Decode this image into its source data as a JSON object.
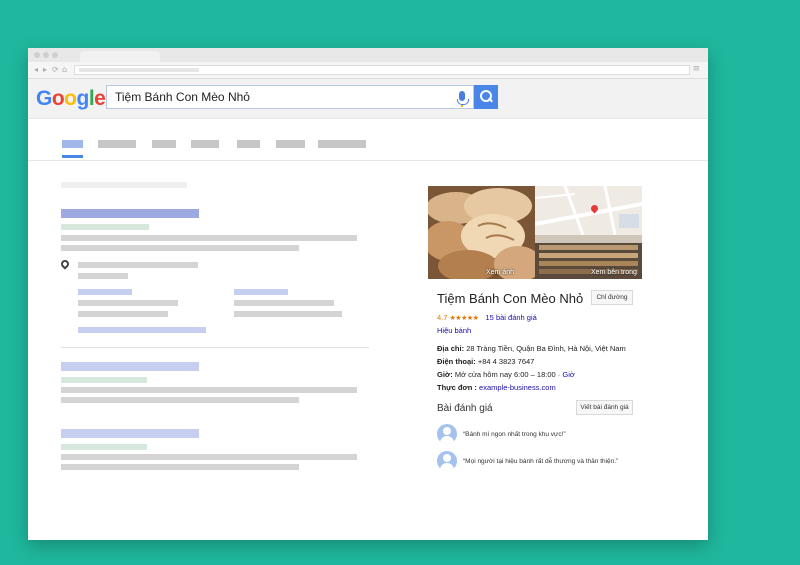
{
  "browser": {
    "menu_glyph": "≡",
    "nav_glyphs": [
      "◂",
      "▸",
      "⟳",
      "⌂"
    ]
  },
  "google": {
    "logo_letters": [
      {
        "ch": "G",
        "color": "#4285f4"
      },
      {
        "ch": "o",
        "color": "#ea4335"
      },
      {
        "ch": "o",
        "color": "#fbbc05"
      },
      {
        "ch": "g",
        "color": "#4285f4"
      },
      {
        "ch": "l",
        "color": "#34a853"
      },
      {
        "ch": "e",
        "color": "#ea4335"
      }
    ],
    "query": "Tiệm Bánh Con Mèo Nhỏ"
  },
  "knowledge_panel": {
    "photo_caption": "Xem ảnh",
    "store_caption": "Xem bên trong",
    "title": "Tiệm Bánh Con Mèo Nhỏ",
    "directions_button": "Chỉ đường",
    "rating_value": "4.7",
    "stars": "★★★★★",
    "review_count": "15 bài đánh giá",
    "category": "Hiệu bánh",
    "address_label": "Địa chỉ:",
    "address_value": "28 Tràng Tiền, Quận Ba Đình, Hà Nội, Việt Nam",
    "phone_label": "Điện thoại:",
    "phone_value": "+84 4 3823 7647",
    "hours_label": "Giờ:",
    "hours_value": "Mở cửa hôm nay 6:00 – 18:00 ·",
    "hours_link": "Giờ",
    "menu_label": "Thực đơn :",
    "menu_link": "example-business.com",
    "reviews_heading": "Bài đánh giá",
    "write_review_button": "Viết bài đánh giá",
    "reviews": [
      "“Bánh mì ngon nhất trong khu vực!”",
      "“Mọi người tại hiệu bánh rất dễ thương và thân thiện.”"
    ]
  }
}
